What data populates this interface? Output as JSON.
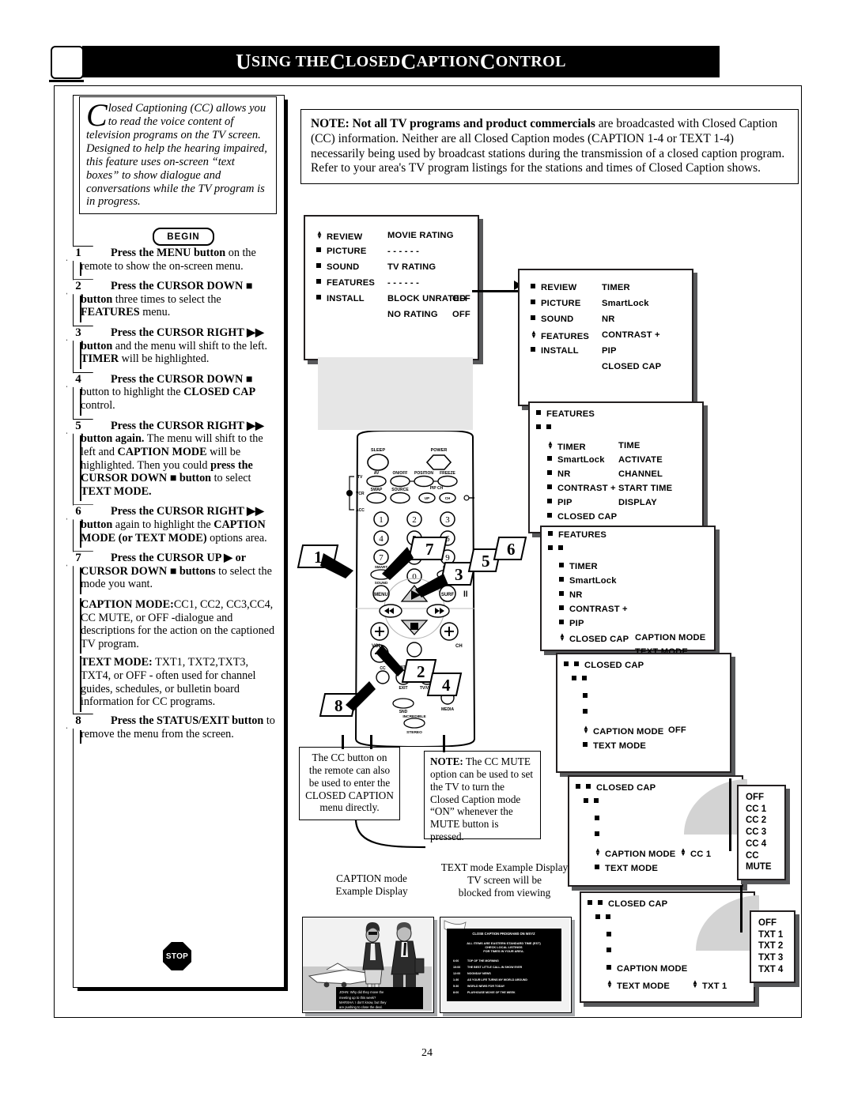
{
  "header": {
    "title_parts": [
      "U",
      "SING THE ",
      "C",
      "LOSED ",
      "C",
      "APTION ",
      "C",
      "ONTROL"
    ],
    "title": "USING THE CLOSED CAPTION CONTROL"
  },
  "intro": {
    "dropcap": "C",
    "text": "losed Captioning (CC) allows you to read the voice content of television programs on the TV screen. Designed to help the hearing impaired, this feature uses on-screen “text boxes” to show dialogue and conversations while the TV program is in progress.",
    "begin_label": "BEGIN"
  },
  "steps": [
    {
      "num": "1",
      "html": "<b>Press the MENU button</b> on the remote to show the on-screen menu."
    },
    {
      "num": "2",
      "html": "<b>Press the CURSOR DOWN ■ button</b> three times to select the <b>FEATURES</b> menu."
    },
    {
      "num": "3",
      "html": "<b>Press the CURSOR RIGHT ▶▶ button</b> and the menu will shift to the left. <b>TIMER</b> will be highlighted."
    },
    {
      "num": "4",
      "html": "<b>Press the CURSOR DOWN ■</b> button to highlight the <b>CLOSED CAP</b> control."
    },
    {
      "num": "5",
      "html": "<b>Press the CURSOR RIGHT ▶▶ button again.</b> The menu will shift to the left and <b>CAPTION MODE</b> will be highlighted. Then you could <b>press the CURSOR DOWN ■ button</b> to select <b>TEXT MODE.</b>"
    },
    {
      "num": "6",
      "html": "<b>Press the CURSOR RIGHT ▶▶ button</b> again to highlight the <b>CAPTION MODE (or TEXT MODE)</b> options area."
    },
    {
      "num": "7",
      "html": "<b>Press the CURSOR UP ▶ or CURSOR DOWN ■ buttons</b> to select the mode you want."
    },
    {
      "num": "8",
      "html": "<b>Press the STATUS/EXIT button</b> to remove the menu from the screen."
    }
  ],
  "mode_info": [
    {
      "html": "<b>CAPTION MODE:</b>CC1, CC2, CC3,CC4, CC MUTE, or OFF -dialogue and descriptions for the action on the captioned TV program."
    },
    {
      "html": "<b>TEXT MODE:</b> TXT1, TXT2,TXT3, TXT4, or OFF - often used for channel guides, schedules, or bulletin board information for CC programs."
    }
  ],
  "stop_label": "STOP",
  "note": {
    "html": "<b>NOTE: Not all TV programs and product commercials</b> are broadcasted with Closed Caption (CC) information. Neither are all Closed Caption modes (CAPTION 1-4 or TEXT 1-4) necessarily being used by broadcast stations during the transmission of a closed caption program. Refer to your area's TV program listings for the stations and times of Closed Caption shows."
  },
  "menu1": {
    "left": [
      "REVIEW",
      "PICTURE",
      "SOUND",
      "FEATURES",
      "INSTALL"
    ],
    "right": [
      "MOVIE RATING",
      "- - - - - -",
      "TV RATING",
      "- - - - - -",
      "BLOCK UNRATED",
      "NO RATING"
    ],
    "values": [
      "OFF",
      "OFF"
    ]
  },
  "menu2": {
    "left": [
      "REVIEW",
      "PICTURE",
      "SOUND",
      "FEATURES",
      "INSTALL"
    ],
    "right": [
      "TIMER",
      "SmartLock",
      "NR",
      "CONTRAST +",
      "PIP",
      "CLOSED CAP"
    ]
  },
  "menu3": {
    "title": "FEATURES",
    "left": [
      "TIMER",
      "SmartLock",
      "NR",
      "CONTRAST +",
      "PIP",
      "CLOSED CAP"
    ],
    "right": [
      "TIME",
      "ACTIVATE",
      "CHANNEL",
      "START TIME",
      "DISPLAY"
    ]
  },
  "menu4": {
    "title": "FEATURES",
    "left": [
      "TIMER",
      "SmartLock",
      "NR",
      "CONTRAST +",
      "PIP",
      "CLOSED CAP"
    ],
    "right": [
      "CAPTION MODE",
      "TEXT MODE"
    ]
  },
  "menu5": {
    "title": "CLOSED CAP",
    "left": [
      "CAPTION MODE",
      "TEXT MODE"
    ],
    "value": "OFF"
  },
  "menu6": {
    "title": "CLOSED CAP",
    "left": [
      "CAPTION MODE",
      "TEXT MODE"
    ],
    "value": "CC 1"
  },
  "menu7": {
    "title": "CLOSED CAP",
    "left": [
      "CAPTION MODE",
      "TEXT MODE"
    ],
    "value": "TXT 1"
  },
  "caption_options": [
    "OFF",
    "CC 1",
    "CC 2",
    "CC 3",
    "CC 4",
    "CC MUTE"
  ],
  "text_options": [
    "OFF",
    "TXT 1",
    "TXT 2",
    "TXT 3",
    "TXT 4"
  ],
  "callout_cc": {
    "text": "The CC button on the remote can also be used to enter the CLOSED CAPTION menu directly."
  },
  "callout_mute": {
    "html": "<b>NOTE:</b> The CC MUTE option can be used to set the TV to turn the Closed Caption mode “ON” whenever the MUTE button is pressed."
  },
  "example_caption_label": "CAPTION mode\nExample Display",
  "example_text_label": "TEXT  mode Example Display\nTV screen will be\nblocked from viewing",
  "caption_overlay": "JOHN: Why did they move the meeting up to this week?\nMARSHA: I don't know, but they are pushing to close the deal.",
  "text_screen": {
    "heading": "CLOSE CAPTION PROGRAMS ON WXYZ",
    "subhead": [
      "ALL ITEMS ARE EASTERN STANDARD TIME (EST)",
      "CHECK LOCAL LISTINGS",
      "FOR TIMES IN YOUR AREA."
    ],
    "rows": [
      {
        "time": "6:00",
        "show": "TOP OF THE MORNING"
      },
      {
        "time": "10:00",
        "show": "THE BEST LITTLE CALL-IN SHOW EVER"
      },
      {
        "time": "12:00",
        "show": "NOONDAY NEWS"
      },
      {
        "time": "1:30",
        "show": "AS YOUR LIFE TURNS MY WORLD AROUND"
      },
      {
        "time": "5:30",
        "show": "WORLD NEWS FOR TODAY"
      },
      {
        "time": "8:00",
        "show": "PLAYHOUSE MOVIE OF THE WEEK"
      }
    ]
  },
  "remote": {
    "buttons_top": [
      "SLEEP",
      "POWER"
    ],
    "row1": [
      "AV",
      "ON/OFF",
      "POSITION",
      "FREEZE"
    ],
    "row2": [
      "SWAP",
      "SOURCE",
      "UP",
      "CH"
    ],
    "row2_label": "PIP CH",
    "side_labels": [
      "TV",
      "VCR",
      "ACC"
    ],
    "keypad": [
      "1",
      "2",
      "3",
      "4",
      "5",
      "6",
      "7",
      "8",
      "9",
      "0"
    ],
    "smart_sound": "SMART SOUND",
    "menu": "MENU",
    "surf": "SURF",
    "vol": "VOL",
    "ch": "CH",
    "mute": "MUTE",
    "cc": "CC",
    "status_exit": "STATUS EXIT",
    "clock": "CLOCK",
    "tv_vcr": "TV/VCR",
    "multi_media": "MULTI MEDIA",
    "incredible_stereo": "INCREDIBLE STEREO",
    "callout_numbers": [
      "1",
      "2",
      "3",
      "4",
      "5",
      "6",
      "7",
      "8"
    ]
  },
  "page_number": "24"
}
